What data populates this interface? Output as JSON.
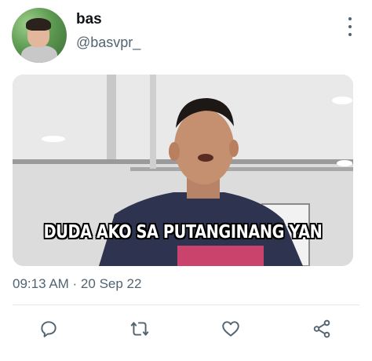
{
  "tweet": {
    "display_name": "bas",
    "handle": "@basvpr_",
    "timestamp": "09:13 AM · 20 Sep 22",
    "media_caption": "DUDA AKO SA PUTANGINANG YAN"
  },
  "icons": {
    "more": "more-vertical-icon",
    "reply": "reply-icon",
    "retweet": "retweet-icon",
    "like": "heart-icon",
    "share": "share-icon"
  },
  "colors": {
    "secondary_text": "#536471",
    "divider": "#e1e8ed"
  }
}
